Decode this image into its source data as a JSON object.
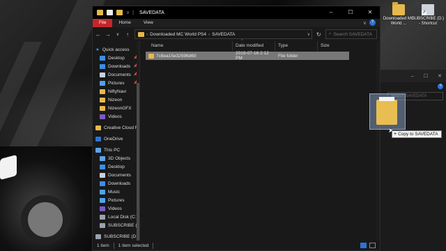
{
  "desktop": {
    "icons": [
      {
        "label": "Downloaded MC World ...",
        "icon": "folder-icon"
      },
      {
        "label": "SUBSCRIBE (D:) - Shortcut",
        "icon": "drive-shortcut-icon"
      }
    ]
  },
  "window": {
    "title": "SAVEDATA",
    "controls": {
      "minimize": "–",
      "maximize": "☐",
      "close": "✕"
    },
    "ribbon": {
      "tabs": [
        "File",
        "Home",
        "View"
      ]
    },
    "address": {
      "crumbs": [
        "Downloaded MC World PS4",
        "SAVEDATA"
      ],
      "search_placeholder": "Search SAVEDATA"
    },
    "nav": {
      "quick_access": "Quick access",
      "items": [
        {
          "label": "Desktop",
          "pinned": true,
          "color": "#3b8ee8"
        },
        {
          "label": "Downloads",
          "pinned": true,
          "color": "#3b8ee8"
        },
        {
          "label": "Documents",
          "pinned": true,
          "color": "#c9d1da"
        },
        {
          "label": "Pictures",
          "pinned": true,
          "color": "#4fa3e8"
        },
        {
          "label": "NiftyNavi",
          "color": "#e6b84e"
        },
        {
          "label": "Nizeon",
          "color": "#e6b84e"
        },
        {
          "label": "NizeonGFX",
          "color": "#e6b84e"
        },
        {
          "label": "Videos",
          "color": "#7b59c4"
        },
        {
          "label": "Creative Cloud Files",
          "color": "#e6b84e"
        },
        {
          "label": "OneDrive",
          "color": "#2a74d6"
        },
        {
          "label": "This PC",
          "color": "#5aa5e8"
        },
        {
          "label": "3D Objects",
          "color": "#5aa5e8"
        },
        {
          "label": "Desktop",
          "color": "#3b8ee8"
        },
        {
          "label": "Documents",
          "color": "#c9d1da"
        },
        {
          "label": "Downloads",
          "color": "#3b8ee8"
        },
        {
          "label": "Music",
          "color": "#4fa3e8"
        },
        {
          "label": "Pictures",
          "color": "#4fa3e8"
        },
        {
          "label": "Videos",
          "color": "#7b59c4"
        },
        {
          "label": "Local Disk (C:)",
          "color": "#9aa3ad"
        },
        {
          "label": "SUBSCRIBE (D:)",
          "color": "#9aa3ad"
        },
        {
          "label": "SUBSCRIBE (D:)",
          "color": "#9aa3ad"
        }
      ]
    },
    "columns": {
      "name": "Name",
      "date": "Date modified",
      "type": "Type",
      "size": "Size"
    },
    "files": [
      {
        "name": "7c8ea15e32596d60",
        "date": "2019-07-16 2:12 PM",
        "type": "File folder",
        "size": ""
      }
    ],
    "status": {
      "count": "1 item",
      "selected": "1 item selected"
    }
  },
  "background_window": {
    "search_placeholder": "Search SAVEDATA"
  },
  "drag": {
    "tooltip": "Copy to SAVEDATA",
    "plus": "+"
  },
  "colors": {
    "accent": "#2a74d6",
    "file_tab": "#c4262a",
    "folder": "#e6b84e"
  }
}
